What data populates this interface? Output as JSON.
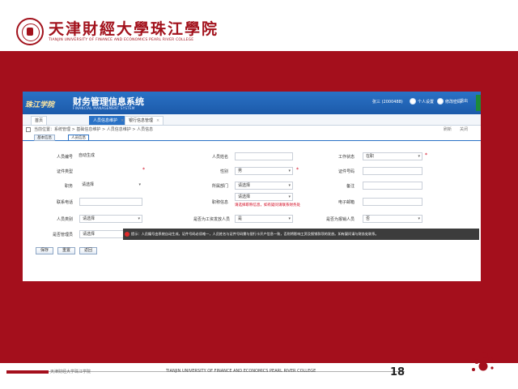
{
  "header": {
    "logo_cn": "天津財經大學珠江學院",
    "logo_en": "TIANJIN UNIVERSITY OF FINANCE AND ECONOMICS PEARL RIVER COLLEGE"
  },
  "app": {
    "brand": "珠江学院",
    "system_cn": "财务管理信息系统",
    "system_en": "FINANCIAL MANAGEMENT SYSTEM",
    "user": "张三 (2000488)",
    "top_links": [
      "个人设置",
      "修改密码",
      "退出"
    ]
  },
  "tabs": [
    {
      "label": "首页"
    },
    {
      "label": "人员信息维护",
      "active": true
    },
    {
      "label": "银行信息管理"
    }
  ],
  "breadcrumb": "当前位置：系统管理 > 基础信息维护 > 人员信息维护 > 人员信息",
  "breadcrumb_right": [
    "刷新",
    "关闭"
  ],
  "subtabs": [
    {
      "label": "基本信息"
    },
    {
      "label": "人员信息",
      "active": true
    }
  ],
  "form": {
    "person_no_label": "人员编号",
    "person_no_value": "自动生成",
    "person_name_label": "人员姓名",
    "work_status_label": "工作状态",
    "work_status_value": "在职",
    "id_type_label": "证件类型",
    "gender_label": "性别",
    "gender_value": "男",
    "id_no_label": "证件号码",
    "position_label": "职务",
    "position_value": "请选择",
    "dept_label": "所属部门",
    "dept_value": "请选择",
    "phone_label": "联系电话",
    "remark_label": "备注",
    "title_label": "职称信息",
    "title_value": "请选择",
    "title_msg": "请选择职称信息，如有疑问请联系财务处",
    "email_label": "电子邮箱",
    "category_label": "人员类别",
    "category_value": "请选择",
    "bank_label": "是否为工资发放人员",
    "bank_value": "是",
    "card_label": "是否为报销人员",
    "card_value": "否",
    "mgr_label": "是否管理员",
    "mgr_value": "请选择"
  },
  "tip": "提示：人员编号由系统自动生成，证件号码必须唯一，人员姓名与证件号码需与银行卡开户信息一致，否则将影响工资及报销款项的发放。如有疑问请与财务处联系。",
  "buttons": [
    "保存",
    "重置",
    "返回"
  ],
  "footer": {
    "cn": "天津财经大学珠江学院",
    "en": "TIANJIN UNIVERSITY OF FINANCE AND ECONOMICS PEARL RIVER COLLEGE",
    "page": "18"
  },
  "colors": {
    "accent_red": "#a40f1c",
    "app_blue": "#2a72c6"
  }
}
